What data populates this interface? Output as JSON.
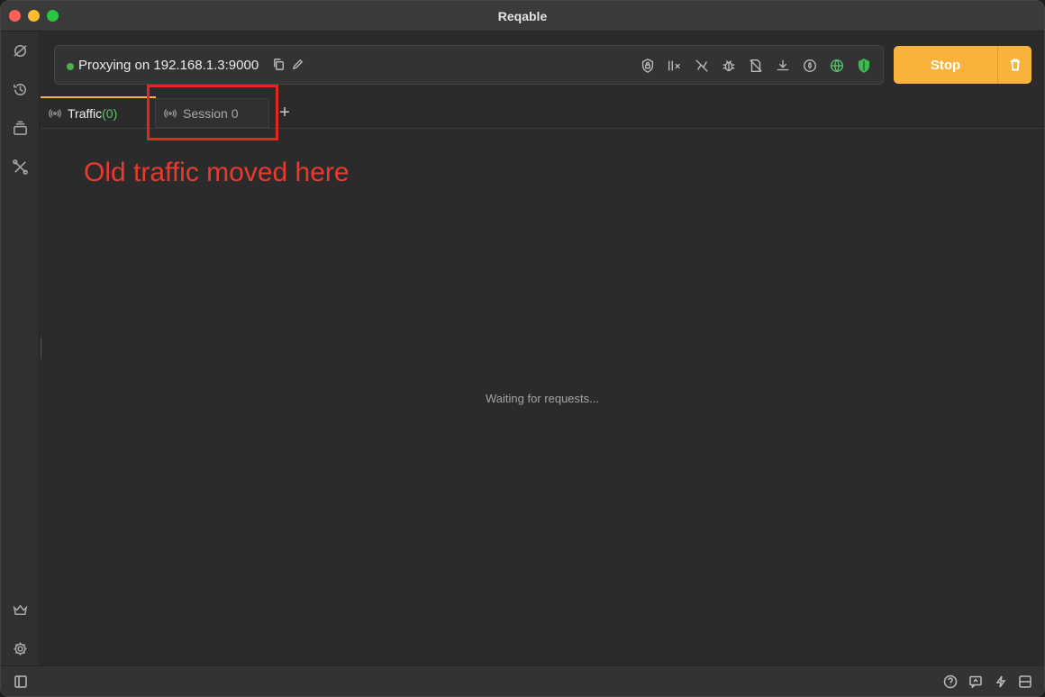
{
  "window": {
    "title": "Reqable"
  },
  "proxy": {
    "status_text": "Proxying on 192.168.1.3:9000",
    "status_color": "#4caf50"
  },
  "toolbar": {
    "icons": [
      "ssl-lock-icon",
      "mute-icon",
      "no-cache-icon",
      "debug-icon",
      "block-icon",
      "download-icon",
      "throttle-icon",
      "global-proxy-icon",
      "shield-icon"
    ],
    "stop_label": "Stop",
    "accent_color": "#f9b33a"
  },
  "tabs": {
    "traffic_label": "Traffic",
    "traffic_count": "(0)",
    "session_label": "Session 0",
    "add_label": "+"
  },
  "annotation": {
    "text": "Old traffic moved here",
    "color": "#ea3a2e"
  },
  "main": {
    "empty_text": "Waiting for requests..."
  },
  "sidebar": {
    "items": [
      "capture-icon",
      "history-icon",
      "collections-icon",
      "tools-icon"
    ],
    "bottom_items": [
      "premium-icon",
      "settings-icon"
    ]
  },
  "bottombar": {
    "items": [
      "sidebar-toggle-icon",
      "help-icon",
      "feedback-icon",
      "shortcut-icon",
      "layout-icon"
    ]
  }
}
